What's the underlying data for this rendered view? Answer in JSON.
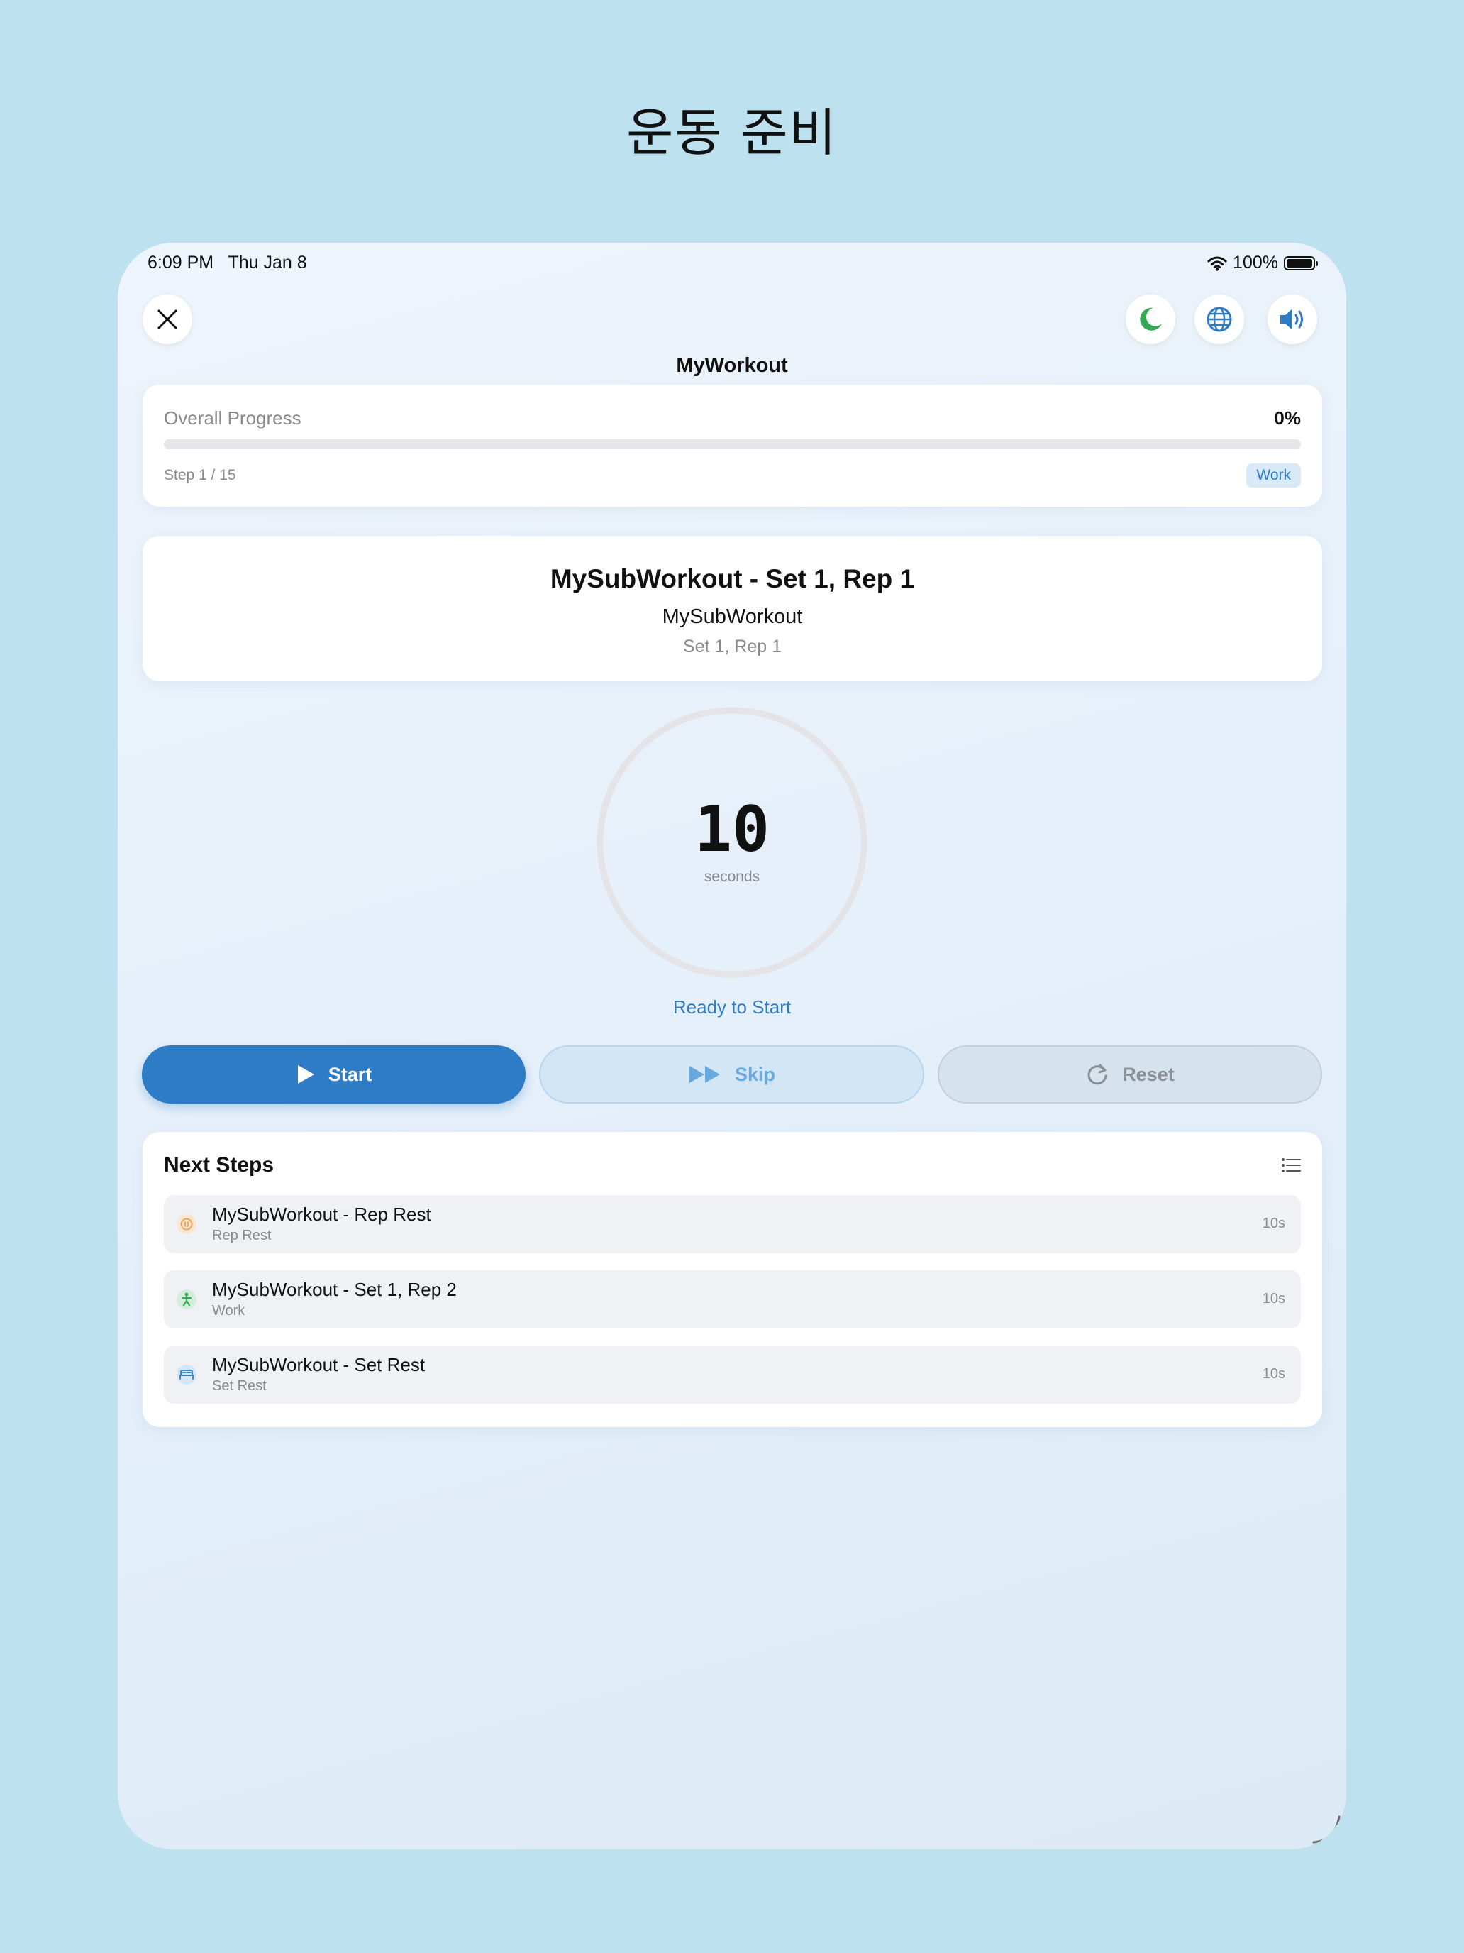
{
  "page_title": "운동 준비",
  "status_bar": {
    "time": "6:09 PM",
    "date": "Thu Jan 8",
    "battery": "100%"
  },
  "toolbar": {
    "close_icon": "close-icon",
    "buttons": [
      {
        "icon": "moon-icon",
        "color": "#34a853"
      },
      {
        "icon": "globe-icon",
        "color": "#2e7bc6"
      },
      {
        "icon": "speaker-icon",
        "color": "#2e7bc6"
      }
    ]
  },
  "workout_title": "MyWorkout",
  "progress": {
    "label": "Overall Progress",
    "value_text": "0%",
    "fraction": 0,
    "step_text": "Step 1 / 15",
    "type_badge": "Work"
  },
  "current_step": {
    "title": "MySubWorkout - Set 1, Rep 1",
    "subtitle": "MySubWorkout",
    "detail": "Set 1, Rep 1"
  },
  "timer": {
    "value": "10",
    "unit": "seconds",
    "status": "Ready to Start"
  },
  "controls": {
    "start": "Start",
    "skip": "Skip",
    "reset": "Reset"
  },
  "next_steps": {
    "title": "Next Steps",
    "items": [
      {
        "name": "MySubWorkout - Rep Rest",
        "type": "Rep Rest",
        "duration": "10s",
        "icon": "pause-icon",
        "color": "#f0a050"
      },
      {
        "name": "MySubWorkout - Set 1, Rep 2",
        "type": "Work",
        "duration": "10s",
        "icon": "running-figure-icon",
        "color": "#34a853"
      },
      {
        "name": "MySubWorkout - Set Rest",
        "type": "Set Rest",
        "duration": "10s",
        "icon": "bed-icon",
        "color": "#2e7bc6"
      }
    ]
  },
  "colors": {
    "accent": "#2e7bc6",
    "background": "#bde1ef"
  }
}
